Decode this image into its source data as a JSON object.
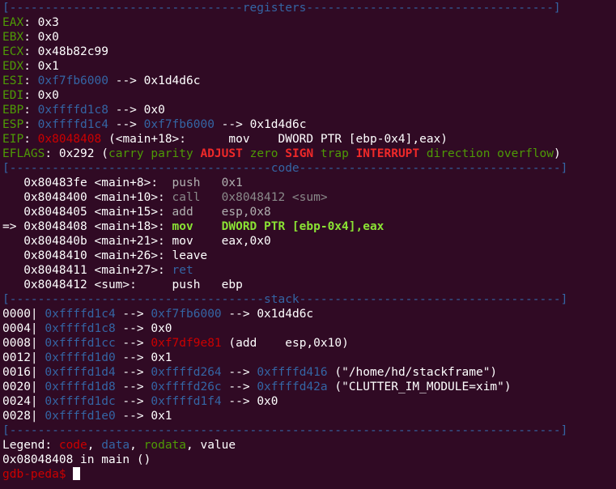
{
  "lines": [
    {
      "kind": "separator",
      "segments": [
        {
          "text": "[---------------------------------registers-----------------------------------]",
          "color": "blue"
        }
      ]
    },
    {
      "kind": "register",
      "segments": [
        {
          "text": "EAX",
          "color": "green"
        },
        {
          "text": ": 0x3",
          "color": "white"
        }
      ]
    },
    {
      "kind": "register",
      "segments": [
        {
          "text": "EBX",
          "color": "green"
        },
        {
          "text": ": 0x0",
          "color": "white"
        }
      ]
    },
    {
      "kind": "register",
      "segments": [
        {
          "text": "ECX",
          "color": "green"
        },
        {
          "text": ": 0x48b82c99",
          "color": "white"
        }
      ]
    },
    {
      "kind": "register",
      "segments": [
        {
          "text": "EDX",
          "color": "green"
        },
        {
          "text": ": 0x1",
          "color": "white"
        }
      ]
    },
    {
      "kind": "register",
      "segments": [
        {
          "text": "ESI",
          "color": "green"
        },
        {
          "text": ": ",
          "color": "white"
        },
        {
          "text": "0xf7fb6000",
          "color": "blue"
        },
        {
          "text": " --> 0x1d4d6c",
          "color": "white"
        }
      ]
    },
    {
      "kind": "register",
      "segments": [
        {
          "text": "EDI",
          "color": "green"
        },
        {
          "text": ": 0x0",
          "color": "white"
        }
      ]
    },
    {
      "kind": "register",
      "segments": [
        {
          "text": "EBP",
          "color": "green"
        },
        {
          "text": ": ",
          "color": "white"
        },
        {
          "text": "0xffffd1c8",
          "color": "blue"
        },
        {
          "text": " --> 0x0",
          "color": "white"
        }
      ]
    },
    {
      "kind": "register",
      "segments": [
        {
          "text": "ESP",
          "color": "green"
        },
        {
          "text": ": ",
          "color": "white"
        },
        {
          "text": "0xffffd1c4",
          "color": "blue"
        },
        {
          "text": " --> ",
          "color": "white"
        },
        {
          "text": "0xf7fb6000",
          "color": "blue"
        },
        {
          "text": " --> 0x1d4d6c",
          "color": "white"
        }
      ]
    },
    {
      "kind": "register",
      "segments": [
        {
          "text": "EIP",
          "color": "green"
        },
        {
          "text": ": ",
          "color": "white"
        },
        {
          "text": "0x8048408",
          "color": "red"
        },
        {
          "text": " (<main+18>:      mov    DWORD PTR [ebp-0x4],eax)",
          "color": "white"
        }
      ]
    },
    {
      "kind": "register",
      "segments": [
        {
          "text": "EFLAGS",
          "color": "green"
        },
        {
          "text": ": 0x292 (",
          "color": "white"
        },
        {
          "text": "carry parity ",
          "color": "green"
        },
        {
          "text": "ADJUST",
          "color": "bred"
        },
        {
          "text": " zero ",
          "color": "green"
        },
        {
          "text": "SIGN",
          "color": "bred"
        },
        {
          "text": " trap ",
          "color": "green"
        },
        {
          "text": "INTERRUPT",
          "color": "bred"
        },
        {
          "text": " direction overflow",
          "color": "green"
        },
        {
          "text": ")",
          "color": "white"
        }
      ]
    },
    {
      "kind": "separator",
      "segments": [
        {
          "text": "[-------------------------------------code-------------------------------------]",
          "color": "blue"
        }
      ]
    },
    {
      "kind": "code",
      "segments": [
        {
          "text": "   0x80483fe <main+8>:  ",
          "color": "white"
        },
        {
          "text": "push   0x1",
          "color": "dim"
        }
      ]
    },
    {
      "kind": "code",
      "segments": [
        {
          "text": "   0x8048400 <main+10>: ",
          "color": "white"
        },
        {
          "text": "call   0x8048412 <sum>",
          "color": "grey"
        }
      ]
    },
    {
      "kind": "code",
      "segments": [
        {
          "text": "   0x8048405 <main+15>: ",
          "color": "white"
        },
        {
          "text": "add    esp,0x8",
          "color": "dim"
        }
      ]
    },
    {
      "kind": "code-current",
      "segments": [
        {
          "text": "=> 0x8048408 <main+18>: ",
          "color": "white"
        },
        {
          "text": "mov    DWORD PTR [ebp-0x4],eax",
          "color": "bgreen"
        }
      ]
    },
    {
      "kind": "code",
      "segments": [
        {
          "text": "   0x804840b <main+21>: mov    eax,0x0",
          "color": "white"
        }
      ]
    },
    {
      "kind": "code",
      "segments": [
        {
          "text": "   0x8048410 <main+26>: leave",
          "color": "white"
        }
      ]
    },
    {
      "kind": "code",
      "segments": [
        {
          "text": "   0x8048411 <main+27>: ",
          "color": "white"
        },
        {
          "text": "ret",
          "color": "blue"
        }
      ]
    },
    {
      "kind": "code",
      "segments": [
        {
          "text": "   0x8048412 <sum>:     push   ebp",
          "color": "white"
        }
      ]
    },
    {
      "kind": "separator",
      "segments": [
        {
          "text": "[------------------------------------stack-------------------------------------]",
          "color": "blue"
        }
      ]
    },
    {
      "kind": "stack",
      "segments": [
        {
          "text": "0000| ",
          "color": "white"
        },
        {
          "text": "0xffffd1c4",
          "color": "blue"
        },
        {
          "text": " --> ",
          "color": "white"
        },
        {
          "text": "0xf7fb6000",
          "color": "blue"
        },
        {
          "text": " --> 0x1d4d6c",
          "color": "white"
        }
      ]
    },
    {
      "kind": "stack",
      "segments": [
        {
          "text": "0004| ",
          "color": "white"
        },
        {
          "text": "0xffffd1c8",
          "color": "blue"
        },
        {
          "text": " --> 0x0",
          "color": "white"
        }
      ]
    },
    {
      "kind": "stack",
      "segments": [
        {
          "text": "0008| ",
          "color": "white"
        },
        {
          "text": "0xffffd1cc",
          "color": "blue"
        },
        {
          "text": " --> ",
          "color": "white"
        },
        {
          "text": "0xf7df9e81",
          "color": "red"
        },
        {
          "text": " (add    esp,0x10)",
          "color": "white"
        }
      ]
    },
    {
      "kind": "stack",
      "segments": [
        {
          "text": "0012| ",
          "color": "white"
        },
        {
          "text": "0xffffd1d0",
          "color": "blue"
        },
        {
          "text": " --> 0x1",
          "color": "white"
        }
      ]
    },
    {
      "kind": "stack",
      "segments": [
        {
          "text": "0016| ",
          "color": "white"
        },
        {
          "text": "0xffffd1d4",
          "color": "blue"
        },
        {
          "text": " --> ",
          "color": "white"
        },
        {
          "text": "0xffffd264",
          "color": "blue"
        },
        {
          "text": " --> ",
          "color": "white"
        },
        {
          "text": "0xffffd416",
          "color": "blue"
        },
        {
          "text": " (\"/home/hd/stackframe\")",
          "color": "white"
        }
      ]
    },
    {
      "kind": "stack",
      "segments": [
        {
          "text": "0020| ",
          "color": "white"
        },
        {
          "text": "0xffffd1d8",
          "color": "blue"
        },
        {
          "text": " --> ",
          "color": "white"
        },
        {
          "text": "0xffffd26c",
          "color": "blue"
        },
        {
          "text": " --> ",
          "color": "white"
        },
        {
          "text": "0xffffd42a",
          "color": "blue"
        },
        {
          "text": " (\"CLUTTER_IM_MODULE=xim\")",
          "color": "white"
        }
      ]
    },
    {
      "kind": "stack",
      "segments": [
        {
          "text": "0024| ",
          "color": "white"
        },
        {
          "text": "0xffffd1dc",
          "color": "blue"
        },
        {
          "text": " --> ",
          "color": "white"
        },
        {
          "text": "0xffffd1f4",
          "color": "blue"
        },
        {
          "text": " --> 0x0",
          "color": "white"
        }
      ]
    },
    {
      "kind": "stack",
      "segments": [
        {
          "text": "0028| ",
          "color": "white"
        },
        {
          "text": "0xffffd1e0",
          "color": "blue"
        },
        {
          "text": " --> 0x1",
          "color": "white"
        }
      ]
    },
    {
      "kind": "separator",
      "segments": [
        {
          "text": "[------------------------------------------------------------------------------]",
          "color": "blue"
        }
      ]
    },
    {
      "kind": "legend",
      "segments": [
        {
          "text": "Legend: ",
          "color": "white"
        },
        {
          "text": "code",
          "color": "red"
        },
        {
          "text": ", ",
          "color": "white"
        },
        {
          "text": "data",
          "color": "blue"
        },
        {
          "text": ", ",
          "color": "white"
        },
        {
          "text": "rodata",
          "color": "green"
        },
        {
          "text": ", value",
          "color": "white"
        }
      ]
    },
    {
      "kind": "output",
      "segments": [
        {
          "text": "0x08048408 in main ()",
          "color": "white"
        }
      ]
    },
    {
      "kind": "prompt",
      "segments": [
        {
          "text": "gdb-peda$",
          "color": "red"
        },
        {
          "text": " ",
          "color": "white"
        }
      ]
    }
  ],
  "colors": {
    "background": "#300a24",
    "white": "#ffffff",
    "blue": "#3465a4",
    "green": "#4e9a06",
    "red": "#cc0000",
    "bred": "#ef2929",
    "dim": "#b0b0b0",
    "grey": "#8a8a8a",
    "bgreen": "#8ae234"
  }
}
